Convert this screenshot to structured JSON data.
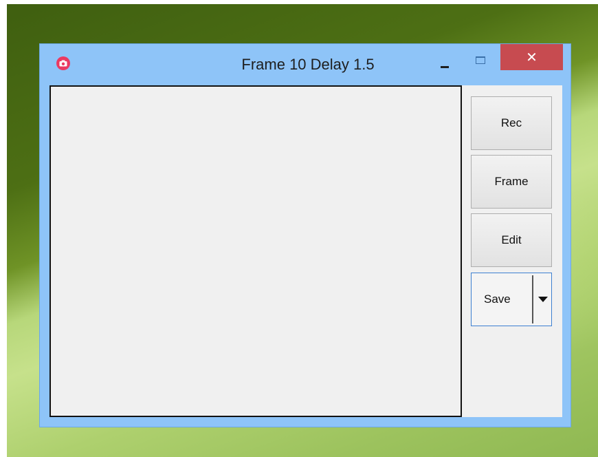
{
  "window": {
    "title": "Frame 10 Delay 1.5",
    "close_glyph": "✕"
  },
  "icons": {
    "app": "camera-icon",
    "minimize": "minimize-icon",
    "maximize": "maximize-icon",
    "close": "close-icon",
    "dropdown": "chevron-down-icon"
  },
  "panel": {
    "rec_label": "Rec",
    "frame_label": "Frame",
    "edit_label": "Edit",
    "save_label": "Save"
  },
  "colors": {
    "titlebar": "#8ec4f8",
    "close_button": "#c74b50",
    "app_icon": "#ea3a62",
    "save_focus_border": "#3c7fd1"
  }
}
